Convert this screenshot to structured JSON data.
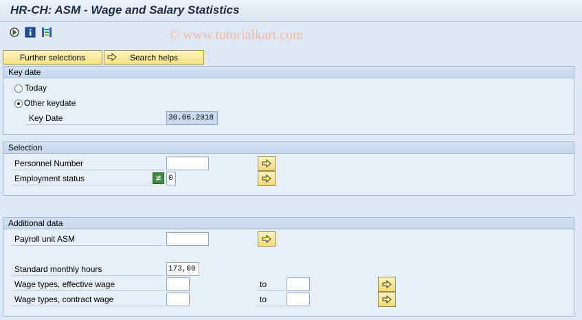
{
  "window": {
    "title": "HR-CH:  ASM - Wage and Salary Statistics"
  },
  "watermark": "© www.tutorialkart.com",
  "toolbar": {
    "icons": [
      "execute-icon",
      "info-icon",
      "variant-icon"
    ]
  },
  "buttons": {
    "further_selections": "Further selections",
    "search_helps": "Search helps"
  },
  "key_date_group": {
    "title": "Key date",
    "today_label": "Today",
    "today_selected": false,
    "other_label": "Other keydate",
    "other_selected": true,
    "key_date_label": "Key Date",
    "key_date_value": "30.06.2018"
  },
  "selection_group": {
    "title": "Selection",
    "personnel_number_label": "Personnel Number",
    "personnel_number_value": "",
    "employment_status_label": "Employment status",
    "employment_status_operator": "≠",
    "employment_status_value": "0"
  },
  "additional_group": {
    "title": "Additional data",
    "payroll_unit_label": "Payroll unit ASM",
    "payroll_unit_value": "",
    "std_hours_label": "Standard monthly hours",
    "std_hours_value": "173,00",
    "wt_effective_label": "Wage types, effective wage",
    "wt_effective_from": "",
    "wt_effective_to_label": "to",
    "wt_effective_to": "",
    "wt_contract_label": "Wage types, contract wage",
    "wt_contract_from": "",
    "wt_contract_to_label": "to",
    "wt_contract_to": ""
  },
  "colors": {
    "background": "#dfe9f5",
    "button_yellow": "#f4e07c",
    "title_text": "#1d2d44"
  }
}
